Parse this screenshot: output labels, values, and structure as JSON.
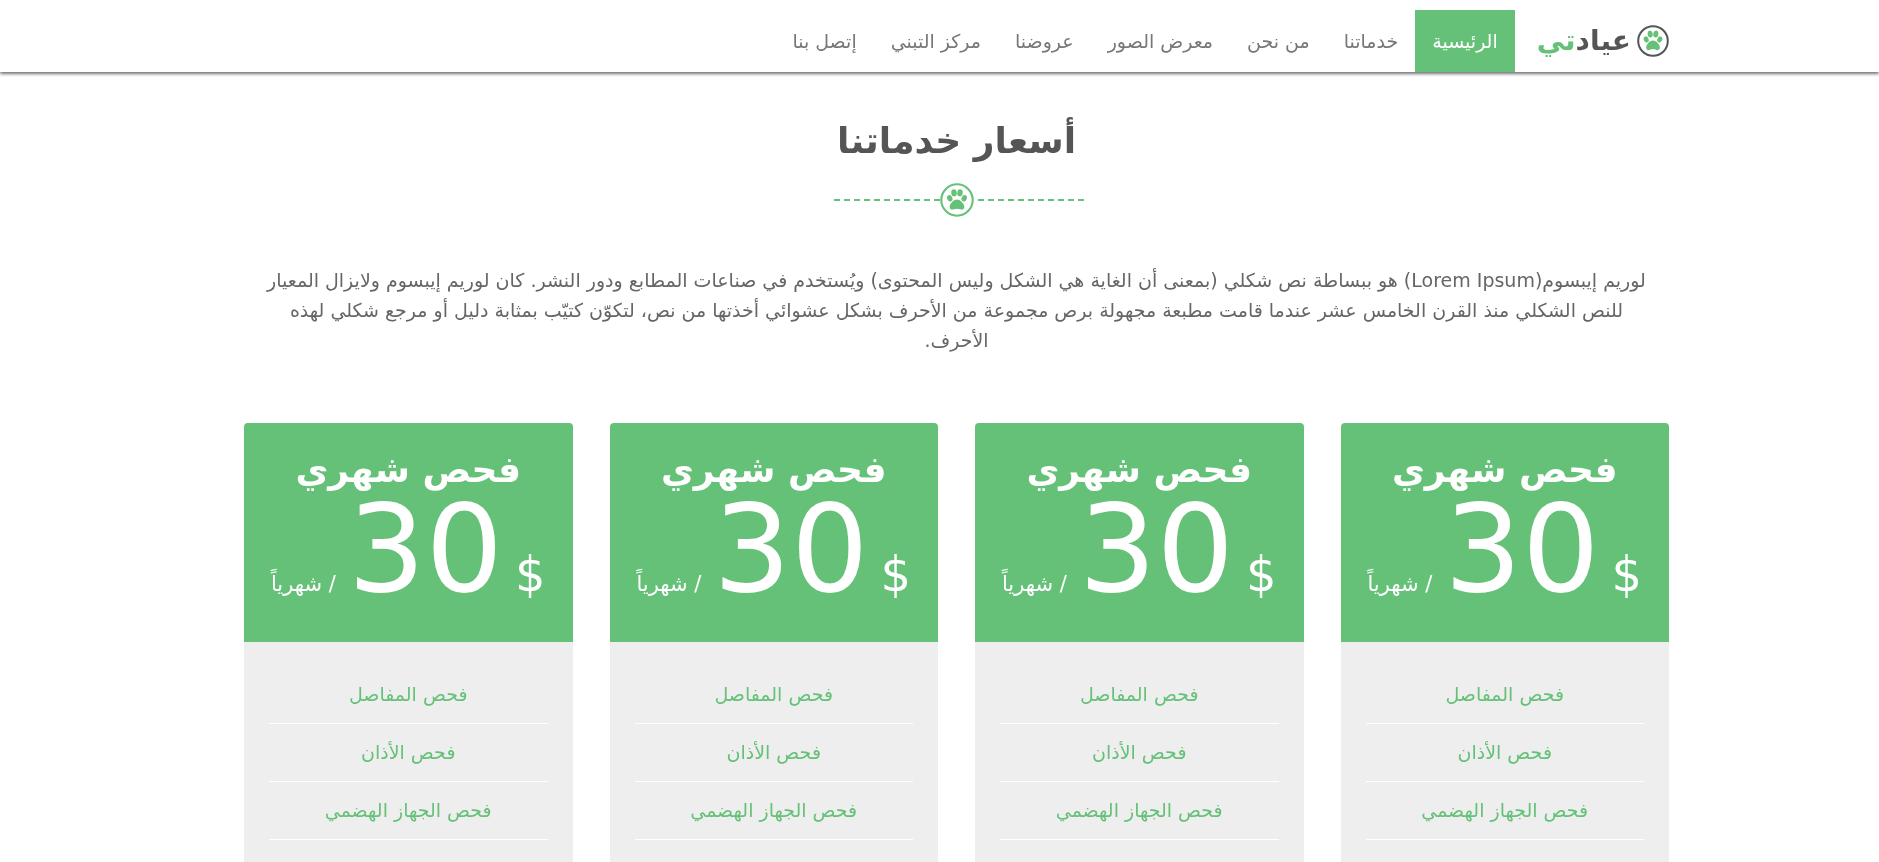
{
  "navbar": {
    "brand": {
      "parts": [
        {
          "text": "عياد",
          "accent": false
        },
        {
          "text": "تي",
          "accent": true
        }
      ]
    },
    "links": [
      {
        "label": "الرئيسية",
        "selected": true
      },
      {
        "label": "خدماتنا",
        "selected": false
      },
      {
        "label": "من نحن",
        "selected": false
      },
      {
        "label": "معرض الصور",
        "selected": false
      },
      {
        "label": "عروضنا",
        "selected": false
      },
      {
        "label": "مركز التبني",
        "selected": false
      },
      {
        "label": "إتصل بنا",
        "selected": false
      }
    ]
  },
  "section": {
    "title": "أسعار خدماتنا",
    "intro": "لوريم إيبسوم(Lorem Ipsum) هو ببساطة نص شكلي (بمعنى أن الغاية هي الشكل وليس المحتوى) ويُستخدم في صناعات المطابع ودور النشر. كان لوريم إيبسوم ولايزال المعيار للنص الشكلي منذ القرن الخامس عشر عندما قامت مطبعة مجهولة برص مجموعة من الأحرف بشكل عشوائي أخذتها من نص، لتكوّن كتيّب بمثابة دليل أو مرجع شكلي لهذه الأحرف."
  },
  "plans": [
    {
      "title": "فحص شهري",
      "currency": "$",
      "price": "30",
      "period": "/ شهرياً",
      "features": [
        "فحص المفاصل",
        "فحص الأذان",
        "فحص الجهاز الهضمي"
      ]
    },
    {
      "title": "فحص شهري",
      "currency": "$",
      "price": "30",
      "period": "/ شهرياً",
      "features": [
        "فحص المفاصل",
        "فحص الأذان",
        "فحص الجهاز الهضمي"
      ]
    },
    {
      "title": "فحص شهري",
      "currency": "$",
      "price": "30",
      "period": "/ شهرياً",
      "features": [
        "فحص المفاصل",
        "فحص الأذان",
        "فحص الجهاز الهضمي"
      ]
    },
    {
      "title": "فحص شهري",
      "currency": "$",
      "price": "30",
      "period": "/ شهرياً",
      "features": [
        "فحص المفاصل",
        "فحص الأذان",
        "فحص الجهاز الهضمي"
      ]
    }
  ]
}
